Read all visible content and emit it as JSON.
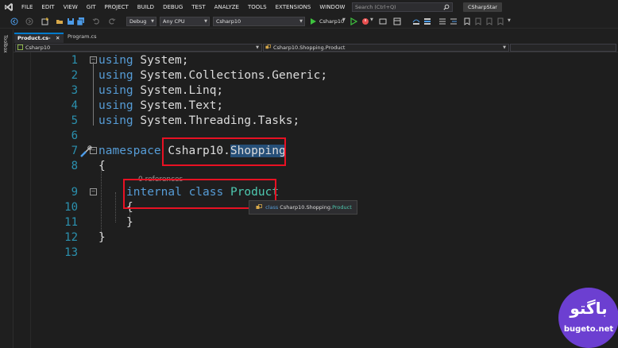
{
  "menubar": {
    "items": [
      "FILE",
      "EDIT",
      "VIEW",
      "GIT",
      "PROJECT",
      "BUILD",
      "DEBUG",
      "TEST",
      "ANALYZE",
      "TOOLS",
      "EXTENSIONS",
      "WINDOW",
      "HELP"
    ],
    "search_placeholder": "Search (Ctrl+Q)",
    "solution_name": "CSharpStar"
  },
  "toolbar": {
    "configuration": "Debug",
    "platform": "Any CPU",
    "startup_project": "Csharp10",
    "run_label": "Csharp10"
  },
  "toolbox": {
    "label": "Toolbox"
  },
  "tabs": [
    {
      "label": "Product.cs",
      "active": true
    },
    {
      "label": "Program.cs",
      "active": false
    }
  ],
  "navbar": {
    "project": "Csharp10",
    "type": "Csharp10.Shopping.Product"
  },
  "editor": {
    "line_numbers": [
      "1",
      "2",
      "3",
      "4",
      "5",
      "6",
      "7",
      "8",
      "9",
      "10",
      "11",
      "12",
      "13"
    ],
    "usings": [
      {
        "kw": "using",
        "ns": "System;"
      },
      {
        "kw": "using",
        "ns": "System.Collections.Generic;"
      },
      {
        "kw": "using",
        "ns": "System.Linq;"
      },
      {
        "kw": "using",
        "ns": "System.Text;"
      },
      {
        "kw": "using",
        "ns": "System.Threading.Tasks;"
      }
    ],
    "namespace_kw": "namespace",
    "namespace_prefix": "Csharp10.",
    "namespace_selected": "Shopping",
    "open_brace": "{",
    "close_brace": "}",
    "references": "0 references",
    "class_modifier": "internal",
    "class_kw": "class",
    "class_name": "Product"
  },
  "tooltip": {
    "kw": "class",
    "qualified": "Csharp10.Shopping.",
    "type": "Product"
  },
  "watermark": {
    "persian": "باگتو",
    "latin": "bugeto.net"
  },
  "colors": {
    "keyword": "#569cd6",
    "type": "#4ec9b0",
    "line_number": "#2b91af",
    "highlight_box": "#e81123",
    "selection": "#264f78"
  }
}
